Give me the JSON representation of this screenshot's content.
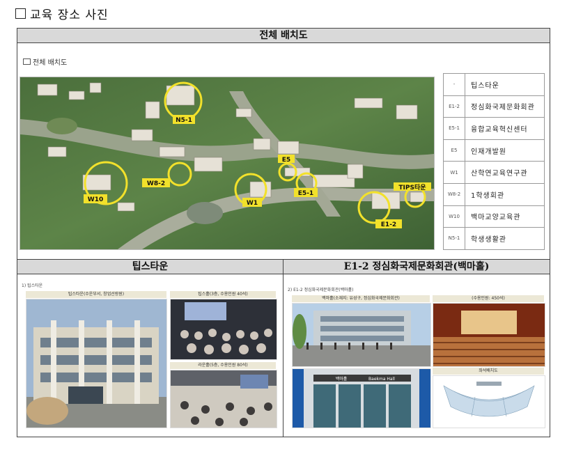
{
  "page": {
    "heading": "교육 장소 사진"
  },
  "overview": {
    "header": "전체 배치도",
    "sublabel": "전체 배치도",
    "map_labels": {
      "n5_1": "N5-1",
      "e5": "E5",
      "w8_2": "W8-2",
      "w10": "W10",
      "w1": "W1",
      "e5_1": "E5-1",
      "tips": "TIPS타운",
      "e1_2": "E1-2"
    },
    "legend": [
      {
        "code": "-",
        "name": "팁스타운"
      },
      {
        "code": "E1-2",
        "name": "정심화국제문화회관"
      },
      {
        "code": "E5-1",
        "name": "융합교육혁신센터"
      },
      {
        "code": "E5",
        "name": "인재개발원"
      },
      {
        "code": "W1",
        "name": "산학연교육연구관"
      },
      {
        "code": "W8-2",
        "name": "1학생회관"
      },
      {
        "code": "W10",
        "name": "백마교양교육관"
      },
      {
        "code": "N5-1",
        "name": "학생생활관"
      }
    ]
  },
  "tips": {
    "header": "팁스타운",
    "sublabel": "1) 팁스타운",
    "cap_main": "팁스타운(수운부서, 창업선랑원)",
    "cap_hall": "팁스홀(3층, 수용인원 40석)",
    "cap_room": "라운홀(5층, 수용인원 80석)"
  },
  "e12": {
    "header": "E1-2 정심화국제문화회관(백마홀)",
    "sublabel": "2) E1-2 정심화국제문화회관(백마홀)",
    "cap_ext": "백마홀(소재지: 유성구, 정심화국제문화회관)",
    "cap_seat": "(수용인원: 450석)",
    "cap_layout": "좌석배치도",
    "sign_kr": "백마홀",
    "sign_en": "Baekma Hall"
  },
  "colors": {
    "header_bg": "#d9d9d9",
    "ring": "#f2e12b",
    "label_bg": "#f2e12b"
  }
}
